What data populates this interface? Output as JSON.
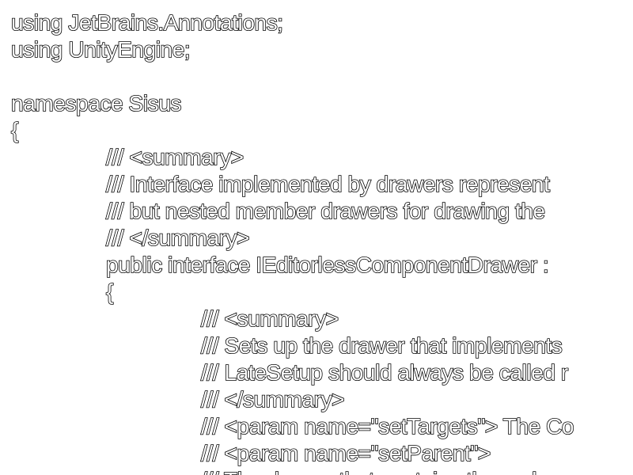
{
  "code": {
    "lines": [
      {
        "text": "using JetBrains.Annotations;",
        "indent": 0
      },
      {
        "text": "using UnityEngine;",
        "indent": 0
      },
      {
        "text": "",
        "indent": 0
      },
      {
        "text": "namespace Sisus",
        "indent": 0
      },
      {
        "text": "{",
        "indent": 0
      },
      {
        "text": "/// <summary>",
        "indent": 1
      },
      {
        "text": "/// Interface implemented by drawers represent",
        "indent": 1
      },
      {
        "text": "/// but nested member drawers for drawing the",
        "indent": 1
      },
      {
        "text": "/// </summary>",
        "indent": 1
      },
      {
        "text": "public interface IEditorlessComponentDrawer :",
        "indent": 1
      },
      {
        "text": "{",
        "indent": 1
      },
      {
        "text": "/// <summary>",
        "indent": 2
      },
      {
        "text": "/// Sets up the drawer that implements",
        "indent": 2
      },
      {
        "text": "/// LateSetup should always be called r",
        "indent": 2
      },
      {
        "text": "/// </summary>",
        "indent": 2
      },
      {
        "text": "/// <param name=\"setTargets\"> The Co",
        "indent": 2
      },
      {
        "text": "/// <param name=\"setParent\">",
        "indent": 2
      },
      {
        "text": "/// The drawer that contains the code",
        "indent": 2
      }
    ]
  }
}
